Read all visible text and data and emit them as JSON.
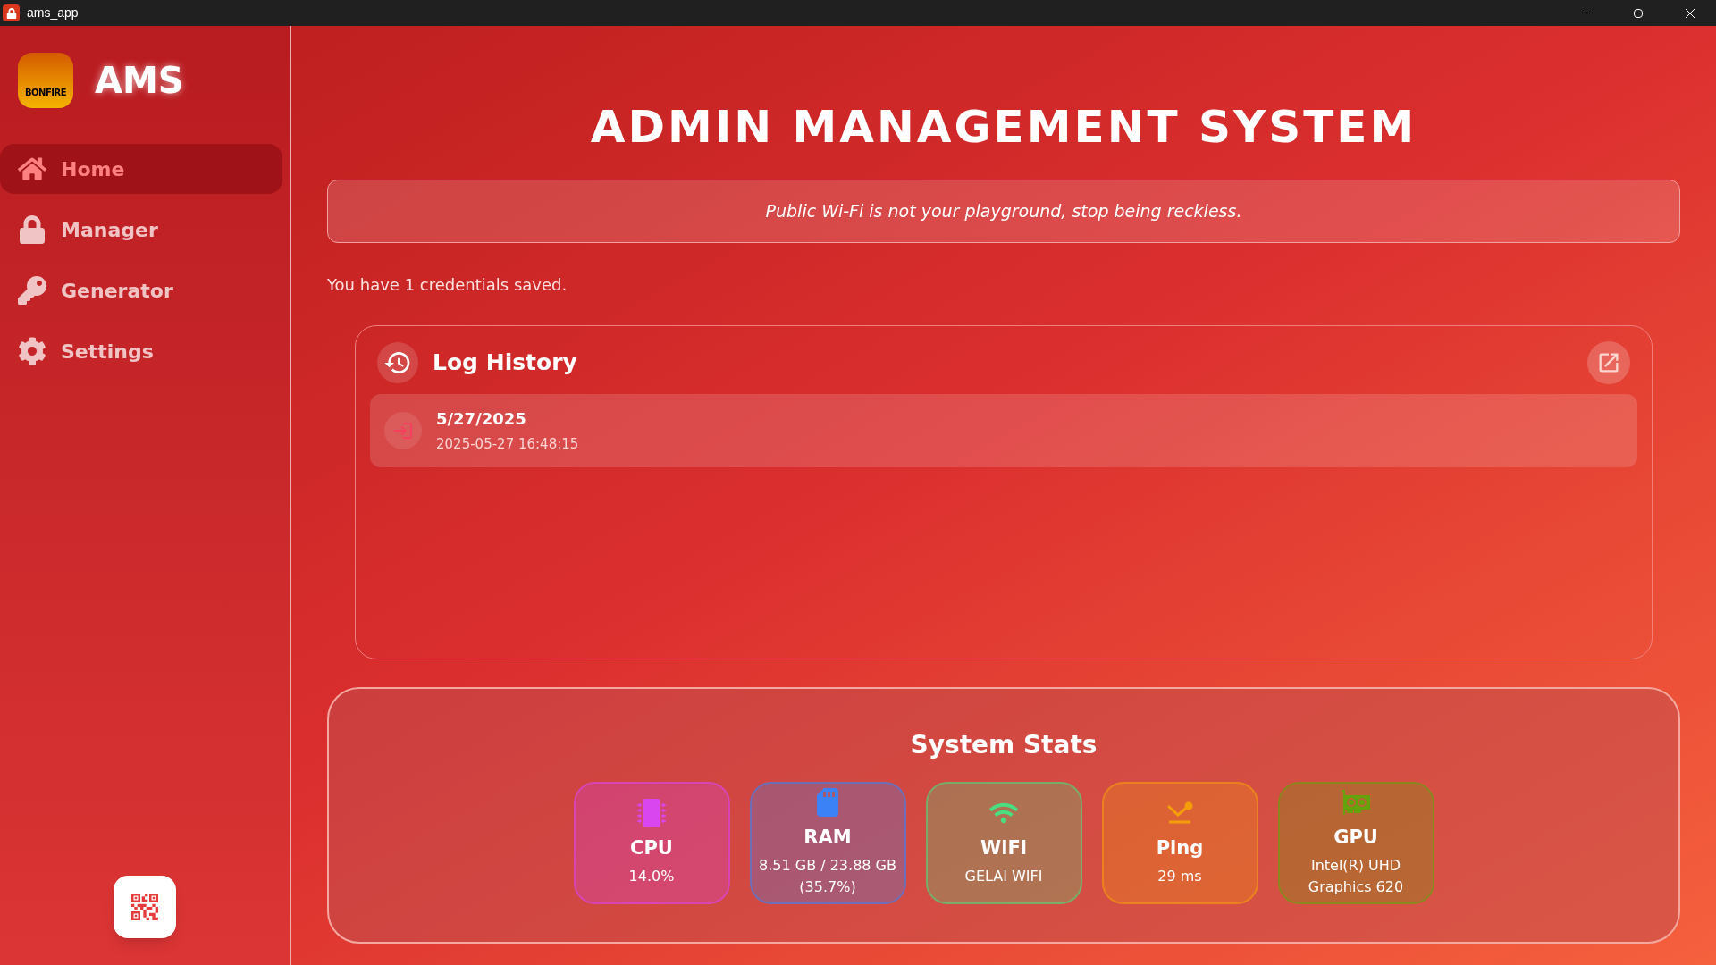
{
  "window": {
    "title": "ams_app"
  },
  "brand": {
    "name": "AMS",
    "logo_text": "BONFIRE"
  },
  "sidebar": {
    "items": [
      {
        "kind": "home",
        "label": "Home",
        "selected": true
      },
      {
        "kind": "lock",
        "label": "Manager",
        "selected": false
      },
      {
        "kind": "key",
        "label": "Generator",
        "selected": false
      },
      {
        "kind": "gear",
        "label": "Settings",
        "selected": false
      }
    ]
  },
  "title": "ADMIN MANAGEMENT SYSTEM",
  "banner": "Public Wi-Fi is not your playground, stop being reckless.",
  "credentials_text": "You have 1 credentials saved.",
  "log_history": {
    "title": "Log History",
    "entries": [
      {
        "date": "5/27/2025",
        "time": "2025-05-27 16:48:15"
      }
    ]
  },
  "system_stats": {
    "title": "System Stats",
    "items": [
      {
        "kind": "cpu",
        "label": "CPU",
        "value": "14.0%",
        "color": "#d946ef"
      },
      {
        "kind": "ram",
        "label": "RAM",
        "value": "8.51 GB / 23.88 GB (35.7%)",
        "color": "#3b82f6"
      },
      {
        "kind": "wifi",
        "label": "WiFi",
        "value": "GELAI WIFI",
        "color": "#4ade80"
      },
      {
        "kind": "ping",
        "label": "Ping",
        "value": "29 ms",
        "color": "#f59e0b"
      },
      {
        "kind": "gpu",
        "label": "GPU",
        "value": "Intel(R) UHD Graphics 620",
        "color": "#65a30d"
      }
    ]
  }
}
